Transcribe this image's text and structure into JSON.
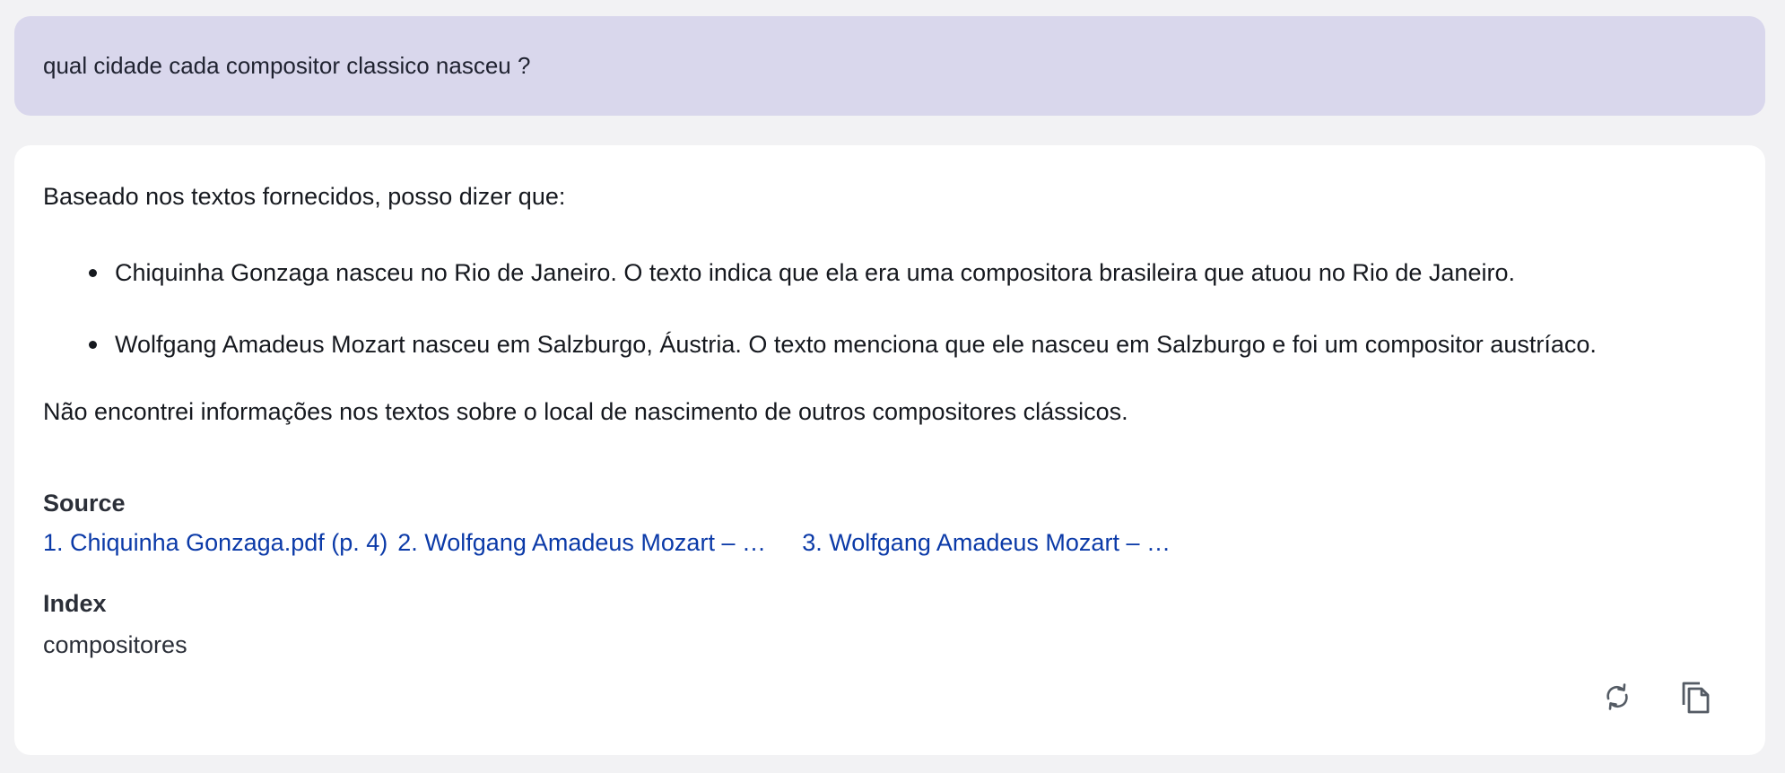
{
  "question": {
    "text": "qual cidade cada compositor classico nasceu ?"
  },
  "answer": {
    "intro": "Baseado nos textos fornecidos, posso dizer que:",
    "bullets": [
      "Chiquinha Gonzaga nasceu no Rio de Janeiro. O texto indica que ela era uma compositora brasileira que atuou no Rio de Janeiro.",
      "Wolfgang Amadeus Mozart nasceu em Salzburgo, Áustria. O texto menciona que ele nasceu em Salzburgo e foi um compositor austríaco."
    ],
    "closing": "Não encontrei informações nos textos sobre o local de nascimento de outros compositores clássicos."
  },
  "source": {
    "heading": "Source",
    "links": [
      "1. Chiquinha Gonzaga.pdf (p. 4)",
      "2. Wolfgang Amadeus Mozart – …",
      "3. Wolfgang Amadeus Mozart – …"
    ]
  },
  "index": {
    "heading": "Index",
    "value": "compositores"
  },
  "actions": {
    "regenerate_icon": "refresh-icon",
    "copy_icon": "copy-icon"
  },
  "colors": {
    "question_bg": "#d9d7ec",
    "link": "#0b3aa8",
    "page_bg": "#f2f2f4",
    "icon": "#545b64"
  }
}
